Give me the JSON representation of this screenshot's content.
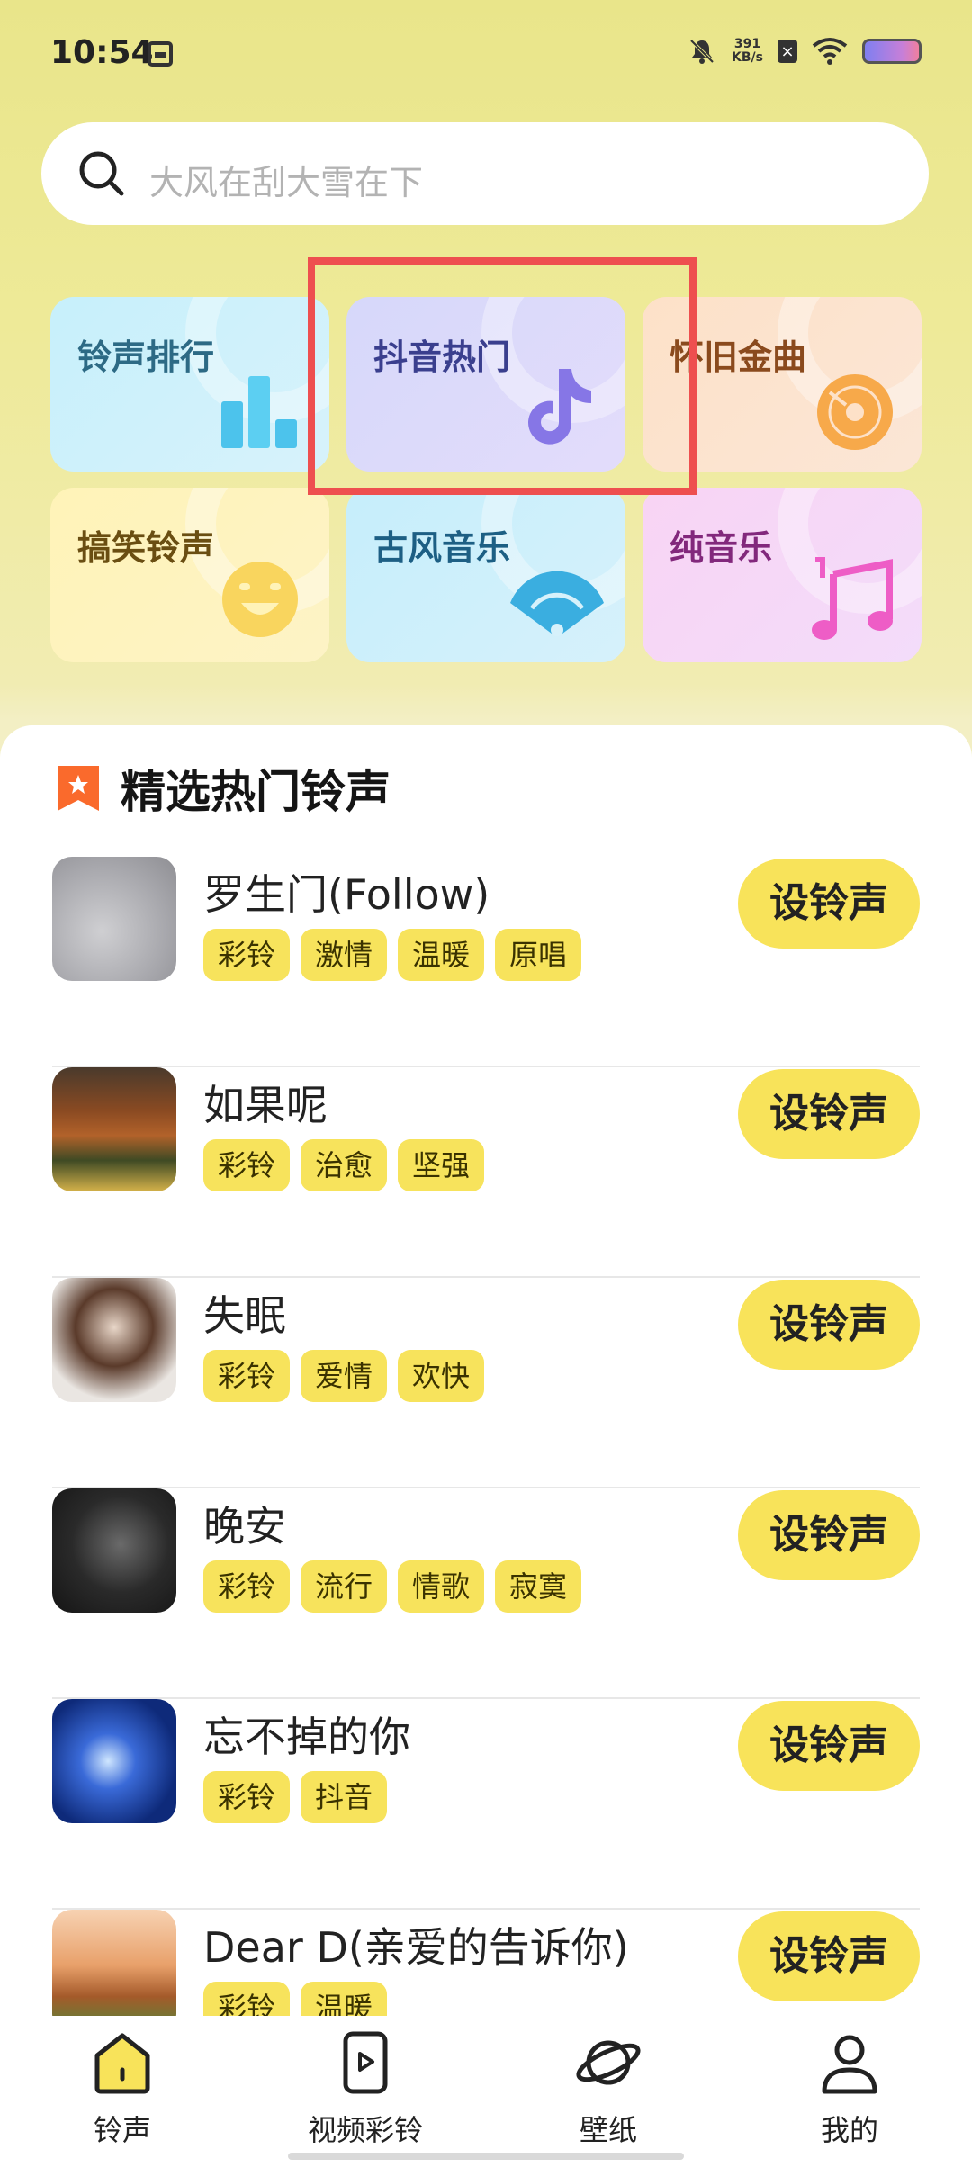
{
  "status_bar": {
    "time": "10:54",
    "net_speed_value": "391",
    "net_speed_unit": "KB/s"
  },
  "search": {
    "placeholder": "大风在刮大雪在下"
  },
  "categories": [
    {
      "label": "铃声排行",
      "icon": "bar-chart-icon"
    },
    {
      "label": "抖音热门",
      "icon": "tiktok-note-icon"
    },
    {
      "label": "怀旧金曲",
      "icon": "vinyl-disc-icon"
    },
    {
      "label": "搞笑铃声",
      "icon": "smiley-icon"
    },
    {
      "label": "古风音乐",
      "icon": "folding-fan-icon"
    },
    {
      "label": "纯音乐",
      "icon": "music-notes-icon"
    }
  ],
  "section": {
    "title": "精选热门铃声"
  },
  "songs": [
    {
      "title": "罗生门(Follow)",
      "tags": [
        "彩铃",
        "激情",
        "温暖",
        "原唱"
      ],
      "button": "设铃声"
    },
    {
      "title": "如果呢",
      "tags": [
        "彩铃",
        "治愈",
        "坚强"
      ],
      "button": "设铃声"
    },
    {
      "title": "失眠",
      "tags": [
        "彩铃",
        "爱情",
        "欢快"
      ],
      "button": "设铃声"
    },
    {
      "title": "晚安",
      "tags": [
        "彩铃",
        "流行",
        "情歌",
        "寂寞"
      ],
      "button": "设铃声"
    },
    {
      "title": "忘不掉的你",
      "tags": [
        "彩铃",
        "抖音"
      ],
      "button": "设铃声"
    },
    {
      "title": "Dear D(亲爱的告诉你)",
      "tags": [
        "彩铃",
        "温暖"
      ],
      "button": "设铃声"
    }
  ],
  "bottom_nav": [
    {
      "label": "铃声",
      "icon": "home-icon"
    },
    {
      "label": "视频彩铃",
      "icon": "video-phone-icon"
    },
    {
      "label": "壁纸",
      "icon": "planet-icon"
    },
    {
      "label": "我的",
      "icon": "profile-icon"
    }
  ],
  "colors": {
    "accent_yellow": "#f8e35a",
    "highlight_red": "#ee4f4f"
  }
}
